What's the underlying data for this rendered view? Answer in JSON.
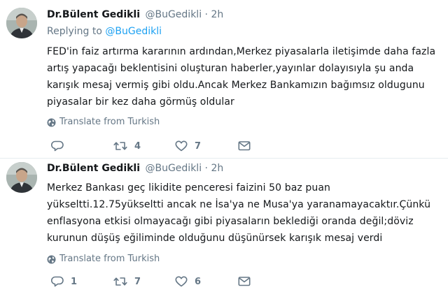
{
  "tweets": [
    {
      "name": "Dr.Bülent Gedikli",
      "handle": "@BuGedikli",
      "dot": "·",
      "time": "2h",
      "replying_prefix": "Replying to ",
      "replying_handle": "@BuGedikli",
      "text": "FED'in faiz artırma kararının ardından,Merkez piyasalarla iletişimde daha fazla artış yapacağı beklentisini oluşturan haberler,yayınlar dolayısıyla şu anda karışık mesaj vermiş gibi oldu.Ancak Merkez Bankamızın bağımsız oldugunu piyasalar bir kez daha görmüş oldular",
      "translate": "Translate from Turkish",
      "reply_count": "",
      "retweet_count": "4",
      "like_count": "7"
    },
    {
      "name": "Dr.Bülent Gedikli",
      "handle": "@BuGedikli",
      "dot": "·",
      "time": "2h",
      "text": "Merkez Bankası geç likidite penceresi faizini 50 baz puan yükseltti.12.75yükseltti ancak ne İsa'ya ne Musa'ya yaranamayacaktır.Çünkü enflasyona etkisi olmayacağı gibi piyasaların beklediği oranda değil;döviz kurunun düşüş eğiliminde olduğunu düşünürsek karışık mesaj verdi",
      "translate": "Translate from Turkish",
      "reply_count": "1",
      "retweet_count": "7",
      "like_count": "6"
    }
  ],
  "icons": {
    "avatar": "avatar",
    "globe": "globe-icon",
    "reply": "reply-icon",
    "retweet": "retweet-icon",
    "like": "heart-icon",
    "dm": "envelope-icon"
  },
  "colors": {
    "text": "#14171a",
    "muted": "#657786",
    "link": "#1da1f2",
    "divider": "#e6ecf0"
  }
}
